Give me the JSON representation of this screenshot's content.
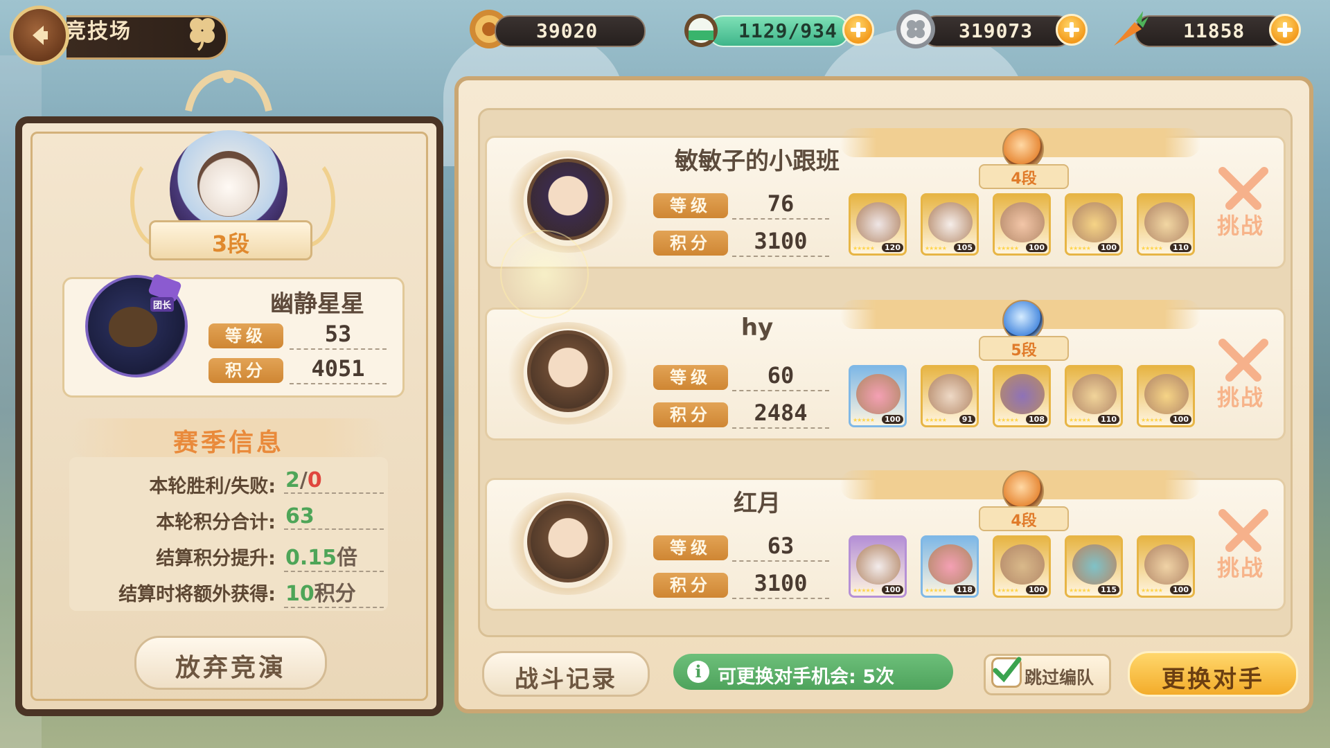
{
  "header": {
    "title": "竞技场"
  },
  "resources": [
    {
      "name": "medal-coin",
      "value": "39020",
      "has_plus": false
    },
    {
      "name": "stamina",
      "value": "1129/934",
      "has_plus": true
    },
    {
      "name": "clover-coin",
      "value": "319073",
      "has_plus": true
    },
    {
      "name": "carrot",
      "value": "11858",
      "has_plus": true
    }
  ],
  "player": {
    "rank": "3段",
    "leader_tag": "团长",
    "name": "幽静星星",
    "level_label": "等级",
    "level": "53",
    "score_label": "积分",
    "score": "4051"
  },
  "season": {
    "title": "赛季信息",
    "rows": [
      {
        "label": "本轮胜利/失败:",
        "win": "2",
        "sep": "/",
        "loss": "0"
      },
      {
        "label": "本轮积分合计:",
        "value": "63"
      },
      {
        "label": "结算积分提升:",
        "value": "0.15",
        "suffix": "倍"
      },
      {
        "label": "结算时将额外获得:",
        "value": "10",
        "suffix": "积分"
      }
    ]
  },
  "abandon_label": "放弃竞演",
  "opponents": [
    {
      "name": "敏敏子的小跟班",
      "rank": "4段",
      "level_label": "等级",
      "level": "76",
      "score_label": "积分",
      "score": "3100",
      "heroes": [
        {
          "level": "120",
          "frame": "#e7b545",
          "skin": "#efe6e6"
        },
        {
          "level": "105",
          "frame": "#e7b545",
          "skin": "#f6eeea"
        },
        {
          "level": "100",
          "frame": "#e7b545",
          "skin": "#f3c6a8"
        },
        {
          "level": "100",
          "frame": "#e7b545",
          "skin": "#f6d486"
        },
        {
          "level": "110",
          "frame": "#e7b545",
          "skin": "#f2d7a3"
        }
      ],
      "challenge_label": "挑战"
    },
    {
      "name": "hy",
      "rank": "5段",
      "level_label": "等级",
      "level": "60",
      "score_label": "积分",
      "score": "2484",
      "heroes": [
        {
          "level": "100",
          "frame": "#7fb8e6",
          "skin": "#f4a0b4"
        },
        {
          "level": "91",
          "frame": "#e7b545",
          "skin": "#eed9c6"
        },
        {
          "level": "108",
          "frame": "#e7b545",
          "skin": "#8e72b8"
        },
        {
          "level": "110",
          "frame": "#e7b545",
          "skin": "#f1d49a"
        },
        {
          "level": "100",
          "frame": "#e7b545",
          "skin": "#f6d486"
        }
      ],
      "challenge_label": "挑战"
    },
    {
      "name": "红月",
      "rank": "4段",
      "level_label": "等级",
      "level": "63",
      "score_label": "积分",
      "score": "3100",
      "heroes": [
        {
          "level": "100",
          "frame": "#b590d6",
          "skin": "#f3ecec"
        },
        {
          "level": "118",
          "frame": "#7fb8e6",
          "skin": "#f4a0b4"
        },
        {
          "level": "100",
          "frame": "#e7b545",
          "skin": "#d9b98a"
        },
        {
          "level": "115",
          "frame": "#e7b545",
          "skin": "#7fc2c8"
        },
        {
          "level": "100",
          "frame": "#e7b545",
          "skin": "#f0d3a6"
        }
      ],
      "challenge_label": "挑战"
    }
  ],
  "footer": {
    "battle_log_label": "战斗记录",
    "refresh_info": "可更换对手机会: 5次",
    "skip_label": "跳过编队",
    "change_label": "更换对手"
  },
  "colors": {
    "accent": "#e98a3b",
    "win": "#4ea558",
    "loss": "#e0463e",
    "panel": "#f4e6cf"
  }
}
